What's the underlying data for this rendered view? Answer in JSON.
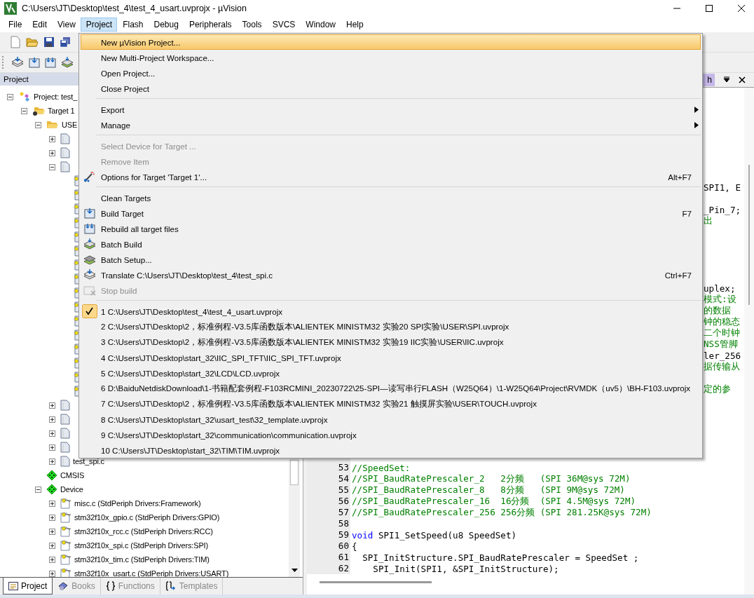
{
  "window": {
    "title": "C:\\Users\\JT\\Desktop\\test_4\\test_4_usart.uvprojx - µVision"
  },
  "menubar": [
    {
      "label": "File",
      "selected": false
    },
    {
      "label": "Edit",
      "selected": false
    },
    {
      "label": "View",
      "selected": false
    },
    {
      "label": "Project",
      "selected": true
    },
    {
      "label": "Flash",
      "selected": false
    },
    {
      "label": "Debug",
      "selected": false
    },
    {
      "label": "Peripherals",
      "selected": false
    },
    {
      "label": "Tools",
      "selected": false
    },
    {
      "label": "SVCS",
      "selected": false
    },
    {
      "label": "Window",
      "selected": false
    },
    {
      "label": "Help",
      "selected": false
    }
  ],
  "project_panel": {
    "title": "Project",
    "tree": [
      {
        "kind": "project",
        "label": "Project: test_",
        "expanded": true,
        "children": [
          {
            "kind": "target",
            "label": "Target 1",
            "expanded": true,
            "children": [
              {
                "kind": "folder",
                "label": "USE",
                "expanded": true,
                "children": [
                  {
                    "kind": "file",
                    "expanded": false
                  },
                  {
                    "kind": "file",
                    "expanded": false
                  },
                  {
                    "kind": "file",
                    "expanded": true,
                    "children": [
                      {
                        "kind": "header"
                      },
                      {
                        "kind": "header"
                      },
                      {
                        "kind": "header"
                      },
                      {
                        "kind": "header"
                      },
                      {
                        "kind": "header"
                      },
                      {
                        "kind": "header"
                      },
                      {
                        "kind": "header"
                      },
                      {
                        "kind": "header"
                      },
                      {
                        "kind": "header"
                      },
                      {
                        "kind": "header"
                      },
                      {
                        "kind": "header"
                      },
                      {
                        "kind": "header"
                      },
                      {
                        "kind": "header"
                      },
                      {
                        "kind": "header"
                      },
                      {
                        "kind": "header"
                      },
                      {
                        "kind": "header"
                      }
                    ]
                  },
                  {
                    "kind": "file",
                    "expanded": false
                  },
                  {
                    "kind": "file",
                    "expanded": false
                  },
                  {
                    "kind": "file",
                    "expanded": false
                  },
                  {
                    "kind": "file",
                    "expanded": false
                  },
                  {
                    "kind": "file",
                    "label": "test_spi.c",
                    "expanded": false
                  }
                ]
              },
              {
                "kind": "package",
                "label": "CMSIS"
              },
              {
                "kind": "package",
                "label": "Device",
                "expanded": true,
                "children": [
                  {
                    "kind": "component",
                    "label": "misc.c (StdPeriph Drivers:Framework)",
                    "expanded": false
                  },
                  {
                    "kind": "component",
                    "label": "stm32f10x_gpio.c (StdPeriph Drivers:GPIO)",
                    "expanded": false
                  },
                  {
                    "kind": "component",
                    "label": "stm32f10x_rcc.c (StdPeriph Drivers:RCC)",
                    "expanded": false
                  },
                  {
                    "kind": "component",
                    "label": "stm32f10x_spi.c (StdPeriph Drivers:SPI)",
                    "expanded": false
                  },
                  {
                    "kind": "component",
                    "label": "stm32f10x_tim.c (StdPeriph Drivers:TIM)",
                    "expanded": false
                  },
                  {
                    "kind": "component",
                    "label": "stm32f10x_usart.c (StdPeriph Drivers:USART)",
                    "expanded": false
                  }
                ]
              }
            ]
          }
        ]
      }
    ],
    "tabs": [
      {
        "label": "Project",
        "selected": true
      },
      {
        "label": "Books",
        "selected": false
      },
      {
        "label": "Functions",
        "selected": false
      },
      {
        "label": "Templates",
        "selected": false
      }
    ]
  },
  "editor": {
    "tab_fragment": "h",
    "fragments": [
      {
        "kind": "code",
        "text": "SPI1, E"
      },
      {
        "kind": "code",
        "text": "_Pin_7;"
      },
      {
        "kind": "comment",
        "text": "出"
      },
      {
        "kind": "code",
        "text": "uplex;"
      },
      {
        "kind": "comment",
        "text": "模式:设"
      },
      {
        "kind": "comment",
        "text": "的数据"
      },
      {
        "kind": "comment",
        "text": "钟的稳态"
      },
      {
        "kind": "comment",
        "text": "二个时钟"
      },
      {
        "kind": "comment",
        "text": "NSS管脚"
      },
      {
        "kind": "code",
        "text": "ler_256"
      },
      {
        "kind": "comment",
        "text": "据传输从"
      },
      {
        "kind": "comment",
        "text": "定的参"
      }
    ],
    "lines": [
      {
        "number": "53",
        "parts": [
          {
            "kind": "comment",
            "text": "//SpeedSet:"
          }
        ]
      },
      {
        "number": "54",
        "parts": [
          {
            "kind": "comment",
            "text": "//SPI_BaudRatePrescaler_2   2分频   (SPI 36M@sys 72M)"
          }
        ]
      },
      {
        "number": "55",
        "parts": [
          {
            "kind": "comment",
            "text": "//SPI_BaudRatePrescaler_8   8分频   (SPI 9M@sys 72M)"
          }
        ]
      },
      {
        "number": "56",
        "parts": [
          {
            "kind": "comment",
            "text": "//SPI_BaudRatePrescaler_16  16分频  (SPI 4.5M@sys 72M)"
          }
        ]
      },
      {
        "number": "57",
        "parts": [
          {
            "kind": "comment",
            "text": "//SPI_BaudRatePrescaler_256 256分频 (SPI 281.25K@sys 72M)"
          }
        ]
      },
      {
        "number": "58"
      },
      {
        "number": "59",
        "parts": [
          {
            "kind": "keyword",
            "text": "void"
          },
          {
            "kind": "code",
            "text": " SPI1_SetSpeed(u8 SpeedSet)"
          }
        ]
      },
      {
        "number": "60",
        "parts": [
          {
            "kind": "code",
            "text": "{"
          }
        ]
      },
      {
        "number": "61",
        "parts": [
          {
            "kind": "code",
            "text": "  SPI_InitStructure.SPI_BaudRatePrescaler = SpeedSet ;"
          }
        ]
      },
      {
        "number": "62",
        "parts": [
          {
            "kind": "code",
            "text": "    SPI_Init(SPI1, &SPI_InitStructure);"
          }
        ]
      }
    ]
  },
  "menu": {
    "items": [
      {
        "kind": "item",
        "label": "New µVision Project...",
        "selected": true,
        "disabled": false
      },
      {
        "kind": "item",
        "label": "New Multi-Project Workspace...",
        "selected": false,
        "disabled": false
      },
      {
        "kind": "item",
        "label": "Open Project...",
        "selected": false,
        "disabled": false
      },
      {
        "kind": "item",
        "label": "Close Project",
        "selected": false,
        "disabled": false
      },
      {
        "kind": "separator"
      },
      {
        "kind": "item",
        "label": "Export",
        "selected": false,
        "disabled": false,
        "submenu": true
      },
      {
        "kind": "item",
        "label": "Manage",
        "selected": false,
        "disabled": false,
        "submenu": true
      },
      {
        "kind": "separator"
      },
      {
        "kind": "item",
        "label": "Select Device for Target ...",
        "selected": false,
        "disabled": true
      },
      {
        "kind": "item",
        "label": "Remove Item",
        "selected": false,
        "disabled": true
      },
      {
        "kind": "item",
        "label": "Options for Target 'Target 1'...",
        "selected": false,
        "disabled": false,
        "shortcut": "Alt+F7"
      },
      {
        "kind": "separator"
      },
      {
        "kind": "item",
        "label": "Clean Targets",
        "selected": false,
        "disabled": false
      },
      {
        "kind": "item",
        "label": "Build Target",
        "selected": false,
        "disabled": false,
        "shortcut": "F7"
      },
      {
        "kind": "item",
        "label": "Rebuild all target files",
        "selected": false,
        "disabled": false
      },
      {
        "kind": "item",
        "label": "Batch Build",
        "selected": false,
        "disabled": false
      },
      {
        "kind": "item",
        "label": "Batch Setup...",
        "selected": false,
        "disabled": false
      },
      {
        "kind": "item",
        "label": "Translate C:\\Users\\JT\\Desktop\\test_4\\test_spi.c",
        "selected": false,
        "disabled": false,
        "shortcut": "Ctrl+F7"
      },
      {
        "kind": "item",
        "label": "Stop build",
        "selected": false,
        "disabled": true
      },
      {
        "kind": "separator"
      }
    ],
    "recent": [
      {
        "label": "1 C:\\Users\\JT\\Desktop\\test_4\\test_4_usart.uvprojx",
        "checked": true
      },
      {
        "label": "2 C:\\Users\\JT\\Desktop\\2，标准例程-V3.5库函数版本\\ALIENTEK MINISTM32 实验20 SPI实验\\USER\\SPI.uvprojx",
        "checked": false
      },
      {
        "label": "3 C:\\Users\\JT\\Desktop\\2，标准例程-V3.5库函数版本\\ALIENTEK MINISTM32 实验19 IIC实验\\USER\\IIC.uvprojx",
        "checked": false
      },
      {
        "label": "4 C:\\Users\\JT\\Desktop\\start_32\\IIC_SPI_TFT\\IIC_SPI_TFT.uvprojx",
        "checked": false
      },
      {
        "label": "5 C:\\Users\\JT\\Desktop\\start_32\\LCD\\LCD.uvprojx",
        "checked": false
      },
      {
        "label": "6 D:\\BaiduNetdiskDownload\\1-书籍配套例程-F103RCMINI_20230722\\25-SPI—读写串行FLASH（W25Q64）\\1-W25Q64\\Project\\RVMDK（uv5）\\BH-F103.uvprojx",
        "checked": false
      },
      {
        "label": "7 C:\\Users\\JT\\Desktop\\2，标准例程-V3.5库函数版本\\ALIENTEK MINISTM32 实验21 触摸屏实验\\USER\\TOUCH.uvprojx",
        "checked": false
      },
      {
        "label": "8 C:\\Users\\JT\\Desktop\\start_32\\usart_test\\32_template.uvprojx",
        "checked": false
      },
      {
        "label": "9 C:\\Users\\JT\\Desktop\\start_32\\communication\\communication.uvprojx",
        "checked": false
      },
      {
        "label": "10 C:\\Users\\JT\\Desktop\\start_32\\TIM\\TIM.uvprojx",
        "checked": false
      }
    ]
  }
}
